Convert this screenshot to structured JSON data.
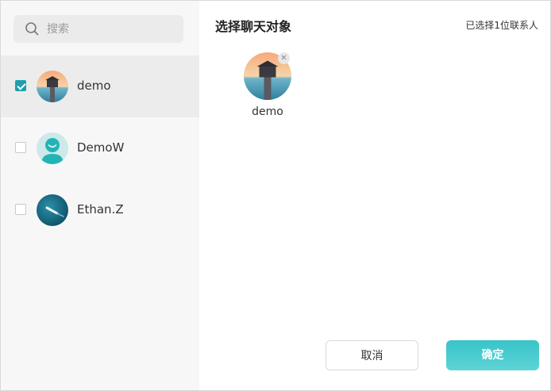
{
  "search": {
    "placeholder": "搜索"
  },
  "contacts": [
    {
      "name": "demo",
      "checked": true
    },
    {
      "name": "DemoW",
      "checked": false
    },
    {
      "name": "Ethan.Z",
      "checked": false
    }
  ],
  "header": {
    "title": "选择聊天对象",
    "selected_count_text": "已选择1位联系人"
  },
  "selected": [
    {
      "name": "demo"
    }
  ],
  "buttons": {
    "cancel": "取消",
    "confirm": "确定"
  },
  "colors": {
    "accent": "#1e9fab",
    "confirm_button": "#4ccbcf"
  }
}
